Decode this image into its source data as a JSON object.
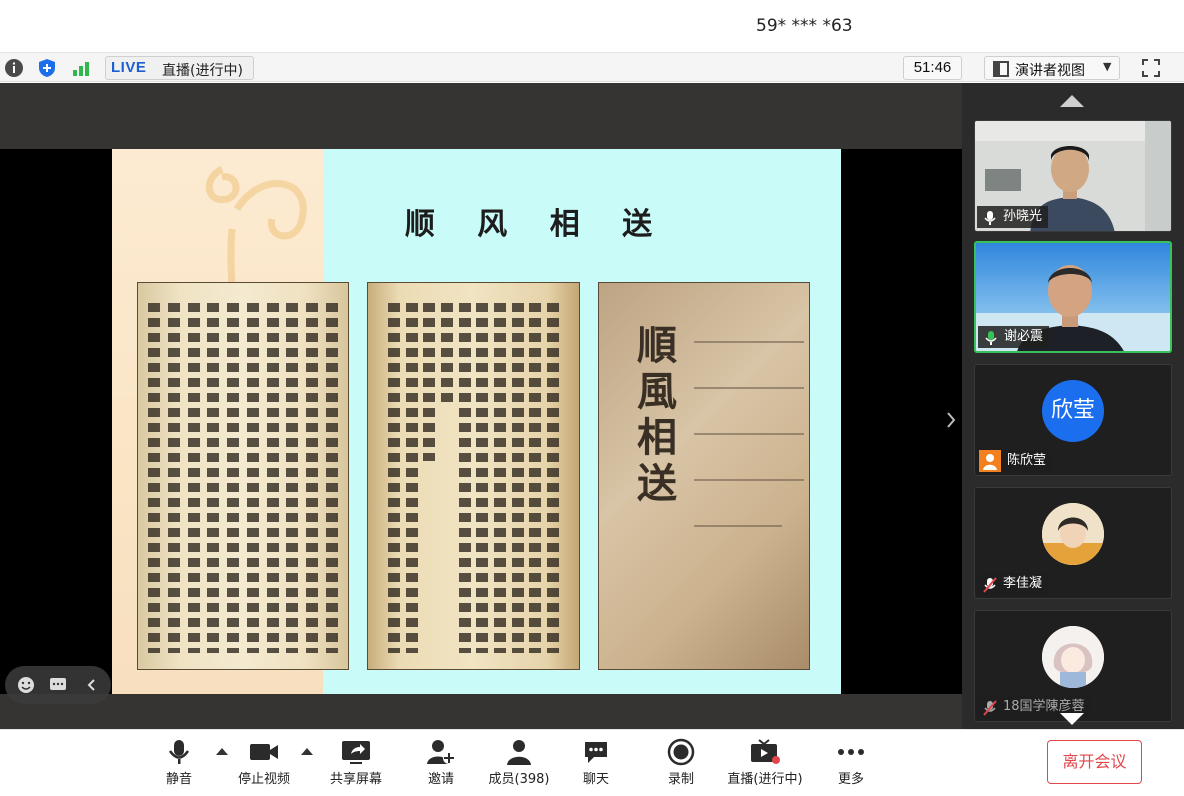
{
  "window": {
    "title": "59* *** *63"
  },
  "statusbar": {
    "live_badge": "LIVE",
    "live_status": "直播(进行中)",
    "timer": "51:46",
    "view_mode": "演讲者视图",
    "icons": [
      "info-icon",
      "shield-icon",
      "signal-icon",
      "layout-icon",
      "fullscreen-icon"
    ],
    "accent_color": "#1c5fd4"
  },
  "slide": {
    "title": "顺 风 相 送",
    "cover_title": "順風相送"
  },
  "participants": [
    {
      "name": "孙晓光",
      "mic": "on",
      "video": true
    },
    {
      "name": "谢必震",
      "mic": "on",
      "video": true,
      "active_speaker": true
    },
    {
      "name": "陈欣莹",
      "avatar_text": "欣莹",
      "avatar_color": "#1b6fee"
    },
    {
      "name": "李佳凝",
      "mic": "muted"
    },
    {
      "name": "18国学陳彦蓉",
      "mic": "muted"
    }
  ],
  "toolbar": {
    "mute": "静音",
    "stop_video": "停止视频",
    "share_screen": "共享屏幕",
    "invite": "邀请",
    "members": "成员(398)",
    "chat": "聊天",
    "record": "录制",
    "live": "直播(进行中)",
    "more": "更多",
    "leave": "离开会议",
    "leave_color": "#e0464a"
  }
}
